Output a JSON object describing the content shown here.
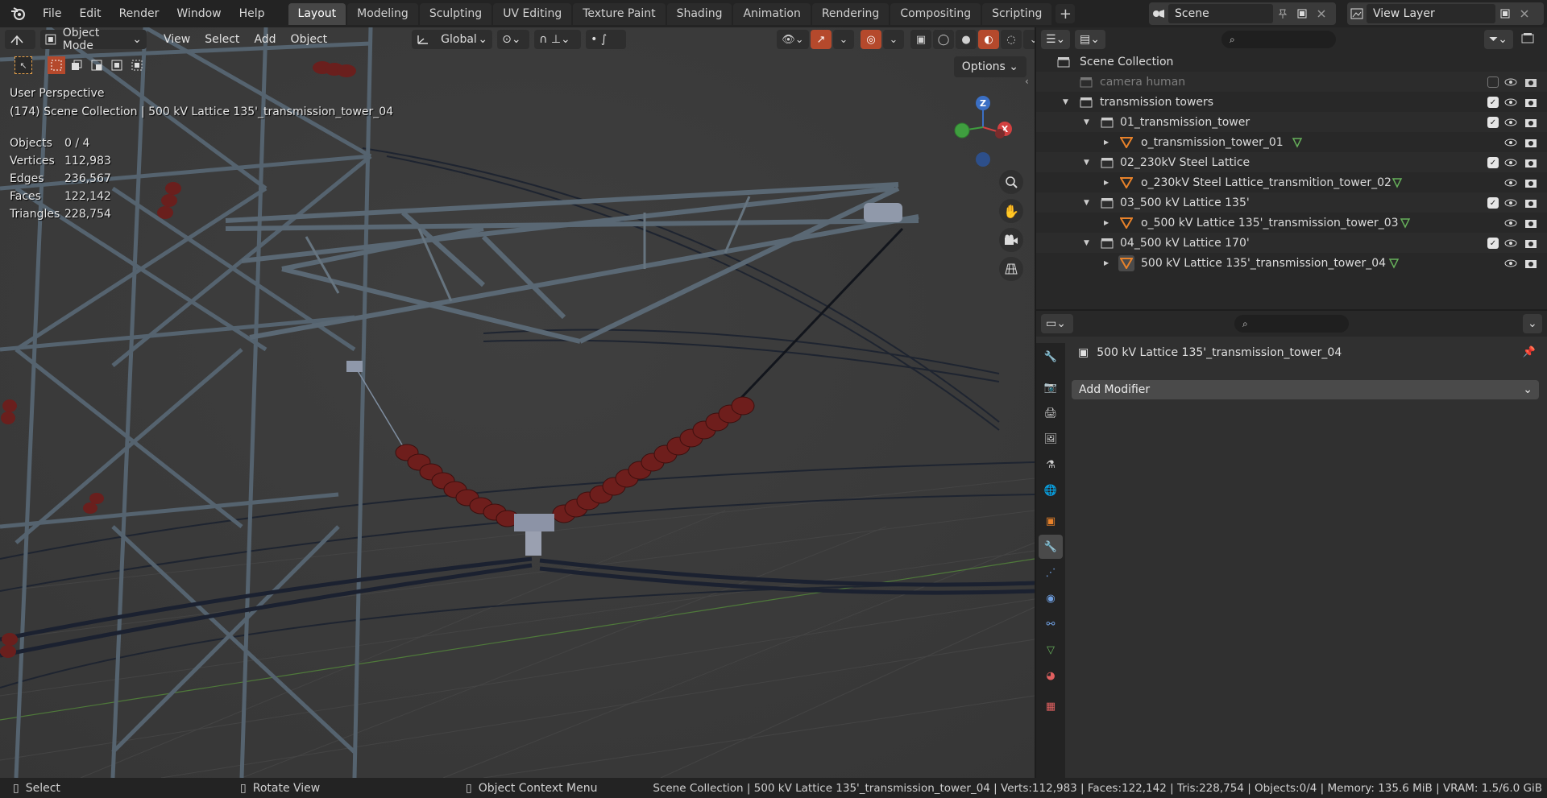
{
  "menu": {
    "items": [
      "File",
      "Edit",
      "Render",
      "Window",
      "Help"
    ]
  },
  "workspaces": {
    "tabs": [
      "Layout",
      "Modeling",
      "Sculpting",
      "UV Editing",
      "Texture Paint",
      "Shading",
      "Animation",
      "Rendering",
      "Compositing",
      "Scripting"
    ],
    "active": "Layout"
  },
  "scene": {
    "label": "Scene"
  },
  "view_layer": {
    "label": "View Layer"
  },
  "viewport_header": {
    "mode": "Object Mode",
    "menus": [
      "View",
      "Select",
      "Add",
      "Object"
    ],
    "orientation": "Global"
  },
  "viewport": {
    "perspective": "User Perspective",
    "collection_info": "(174) Scene Collection | 500 kV Lattice 135'_transmission_tower_04",
    "options_label": "Options",
    "stats": [
      {
        "label": "Objects",
        "value": "0 / 4"
      },
      {
        "label": "Vertices",
        "value": "112,983"
      },
      {
        "label": "Edges",
        "value": "236,567"
      },
      {
        "label": "Faces",
        "value": "122,142"
      },
      {
        "label": "Triangles",
        "value": "228,754"
      }
    ],
    "gizmo": {
      "z": "Z",
      "x": "X"
    }
  },
  "outliner": {
    "rows": [
      {
        "name": "Scene Collection",
        "type": "scene",
        "level": 0
      },
      {
        "name": "camera human",
        "type": "collection",
        "level": 1,
        "dimmed": true,
        "checked": false
      },
      {
        "name": "transmission towers",
        "type": "collection",
        "level": 1,
        "checked": true
      },
      {
        "name": "01_transmission_tower",
        "type": "collection",
        "level": 2,
        "checked": true
      },
      {
        "name": "o_transmission_tower_01",
        "type": "mesh",
        "level": 3
      },
      {
        "name": "02_230kV Steel Lattice",
        "type": "collection",
        "level": 2,
        "checked": true
      },
      {
        "name": "o_230kV Steel Lattice_transmition_tower_02",
        "type": "mesh",
        "level": 3
      },
      {
        "name": "03_500 kV Lattice 135'",
        "type": "collection",
        "level": 2,
        "checked": true
      },
      {
        "name": "o_500 kV Lattice 135'_transmission_tower_03",
        "type": "mesh",
        "level": 3
      },
      {
        "name": "04_500 kV Lattice 170'",
        "type": "collection",
        "level": 2,
        "checked": true
      },
      {
        "name": "500 kV Lattice 135'_transmission_tower_04",
        "type": "mesh",
        "level": 3,
        "selected": true
      }
    ]
  },
  "properties": {
    "object_name": "500 kV Lattice 135'_transmission_tower_04",
    "add_modifier_label": "Add Modifier"
  },
  "statusbar": {
    "select": "Select",
    "rotate": "Rotate View",
    "context": "Object Context Menu",
    "info": "Scene Collection | 500 kV Lattice 135'_transmission_tower_04 | Verts:112,983 | Faces:122,142 | Tris:228,754 | Objects:0/4 | Memory: 135.6 MiB | VRAM: 1.5/6.0 GiB"
  },
  "colors": {
    "accent": "#4772b3",
    "active_orange": "#e8822a",
    "insulator": "#6e1e1c",
    "steel": "#505d6a"
  }
}
